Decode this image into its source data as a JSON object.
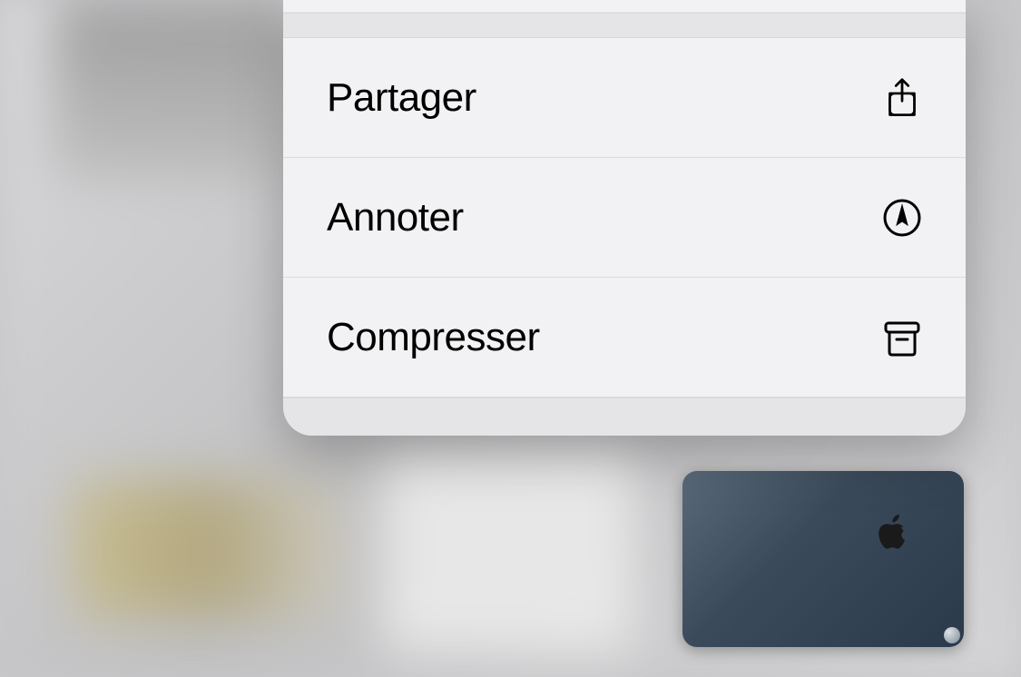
{
  "context_menu": {
    "items": [
      {
        "label": "Partager",
        "icon": "share-icon"
      },
      {
        "label": "Annoter",
        "icon": "markup-icon"
      },
      {
        "label": "Compresser",
        "icon": "archive-box-icon"
      }
    ]
  },
  "thumbnail": {
    "description": "apple-logo-device-back"
  }
}
